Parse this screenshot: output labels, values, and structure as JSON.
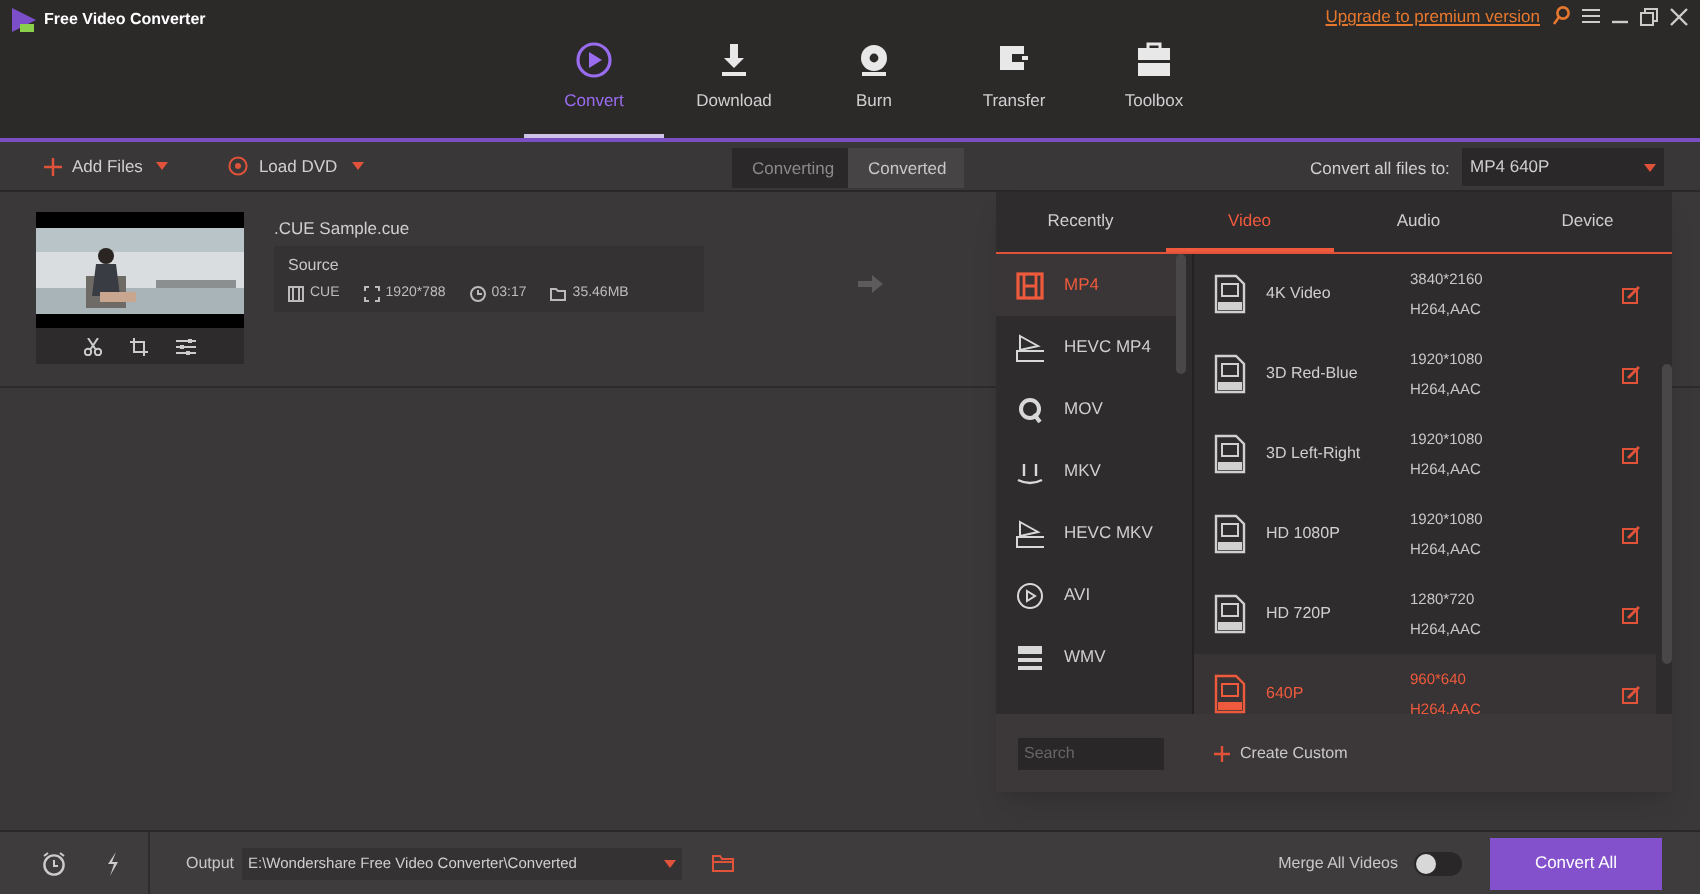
{
  "app": {
    "title": "Free Video Converter",
    "upgrade_link": "Upgrade to premium version"
  },
  "nav": [
    {
      "label": "Convert",
      "kind": "convert",
      "selected": true
    },
    {
      "label": "Download",
      "kind": "download",
      "selected": false
    },
    {
      "label": "Burn",
      "kind": "burn",
      "selected": false
    },
    {
      "label": "Transfer",
      "kind": "transfer",
      "selected": false
    },
    {
      "label": "Toolbox",
      "kind": "toolbox",
      "selected": false
    }
  ],
  "toolbar": {
    "add_files": "Add Files",
    "load_dvd": "Load DVD",
    "tabs": [
      {
        "label": "Converting",
        "selected": true
      },
      {
        "label": "Converted",
        "selected": false
      }
    ],
    "convert_all_label": "Convert all files to:",
    "format_value": "MP4 640P"
  },
  "file": {
    "name": ".CUE Sample.cue",
    "source_label": "Source",
    "format": "CUE",
    "resolution": "1920*788",
    "duration": "03:17",
    "size": "35.46MB"
  },
  "format_panel": {
    "tabs": [
      {
        "label": "Recently",
        "selected": false
      },
      {
        "label": "Video",
        "selected": true
      },
      {
        "label": "Audio",
        "selected": false
      },
      {
        "label": "Device",
        "selected": false
      }
    ],
    "formats": [
      {
        "label": "MP4",
        "kind": "film",
        "selected": true
      },
      {
        "label": "HEVC MP4",
        "kind": "hevc",
        "selected": false
      },
      {
        "label": "MOV",
        "kind": "q",
        "selected": false
      },
      {
        "label": "MKV",
        "kind": "mkv",
        "selected": false
      },
      {
        "label": "HEVC MKV",
        "kind": "hevc",
        "selected": false
      },
      {
        "label": "AVI",
        "kind": "play",
        "selected": false
      },
      {
        "label": "WMV",
        "kind": "wmv",
        "selected": false
      }
    ],
    "presets": [
      {
        "name": "4K Video",
        "resolution": "3840*2160",
        "codec": "H264,AAC",
        "selected": false
      },
      {
        "name": "3D Red-Blue",
        "resolution": "1920*1080",
        "codec": "H264,AAC",
        "selected": false
      },
      {
        "name": "3D Left-Right",
        "resolution": "1920*1080",
        "codec": "H264,AAC",
        "selected": false
      },
      {
        "name": "HD 1080P",
        "resolution": "1920*1080",
        "codec": "H264,AAC",
        "selected": false
      },
      {
        "name": "HD 720P",
        "resolution": "1280*720",
        "codec": "H264,AAC",
        "selected": false
      },
      {
        "name": "640P",
        "resolution": "960*640",
        "codec": "H264,AAC",
        "selected": true
      }
    ],
    "search_placeholder": "Search",
    "create_custom": "Create Custom"
  },
  "bottom": {
    "output_label": "Output",
    "output_path": "E:\\Wondershare Free Video Converter\\Converted",
    "merge_label": "Merge All Videos",
    "merge_on": false,
    "convert_all": "Convert All"
  }
}
